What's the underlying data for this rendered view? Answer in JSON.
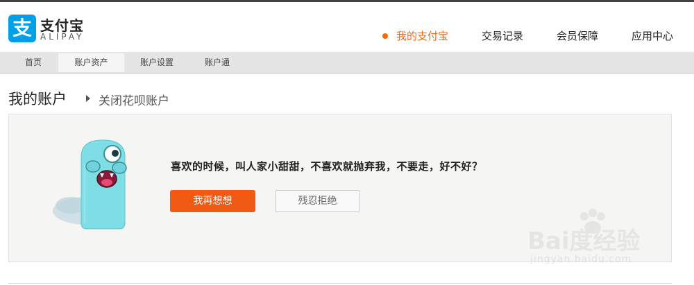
{
  "header": {
    "logo_mark": "支",
    "logo_cn": "支付宝",
    "logo_en": "ALIPAY",
    "nav": [
      {
        "label": "我的支付宝",
        "active": true
      },
      {
        "label": "交易记录",
        "active": false
      },
      {
        "label": "会员保障",
        "active": false
      },
      {
        "label": "应用中心",
        "active": false
      }
    ]
  },
  "subnav": {
    "items": [
      {
        "label": "首页",
        "active": false
      },
      {
        "label": "账户资产",
        "active": true
      },
      {
        "label": "账户设置",
        "active": false
      },
      {
        "label": "账户通",
        "active": false
      }
    ]
  },
  "page": {
    "title": "我的账户",
    "breadcrumb": "关闭花呗账户"
  },
  "panel": {
    "message": "喜欢的时候，叫人家小甜甜，不喜欢就抛弃我，不要走，好不好？",
    "primary_button": "我再想想",
    "secondary_button": "残忍拒绝"
  },
  "watermark": {
    "brand": "Bai度经验",
    "url": "jingyan.baidu.com"
  },
  "colors": {
    "accent": "#ff6600",
    "primary_button": "#f15a12",
    "logo_blue": "#00a0e9",
    "monster_body": "#7fdde6"
  }
}
